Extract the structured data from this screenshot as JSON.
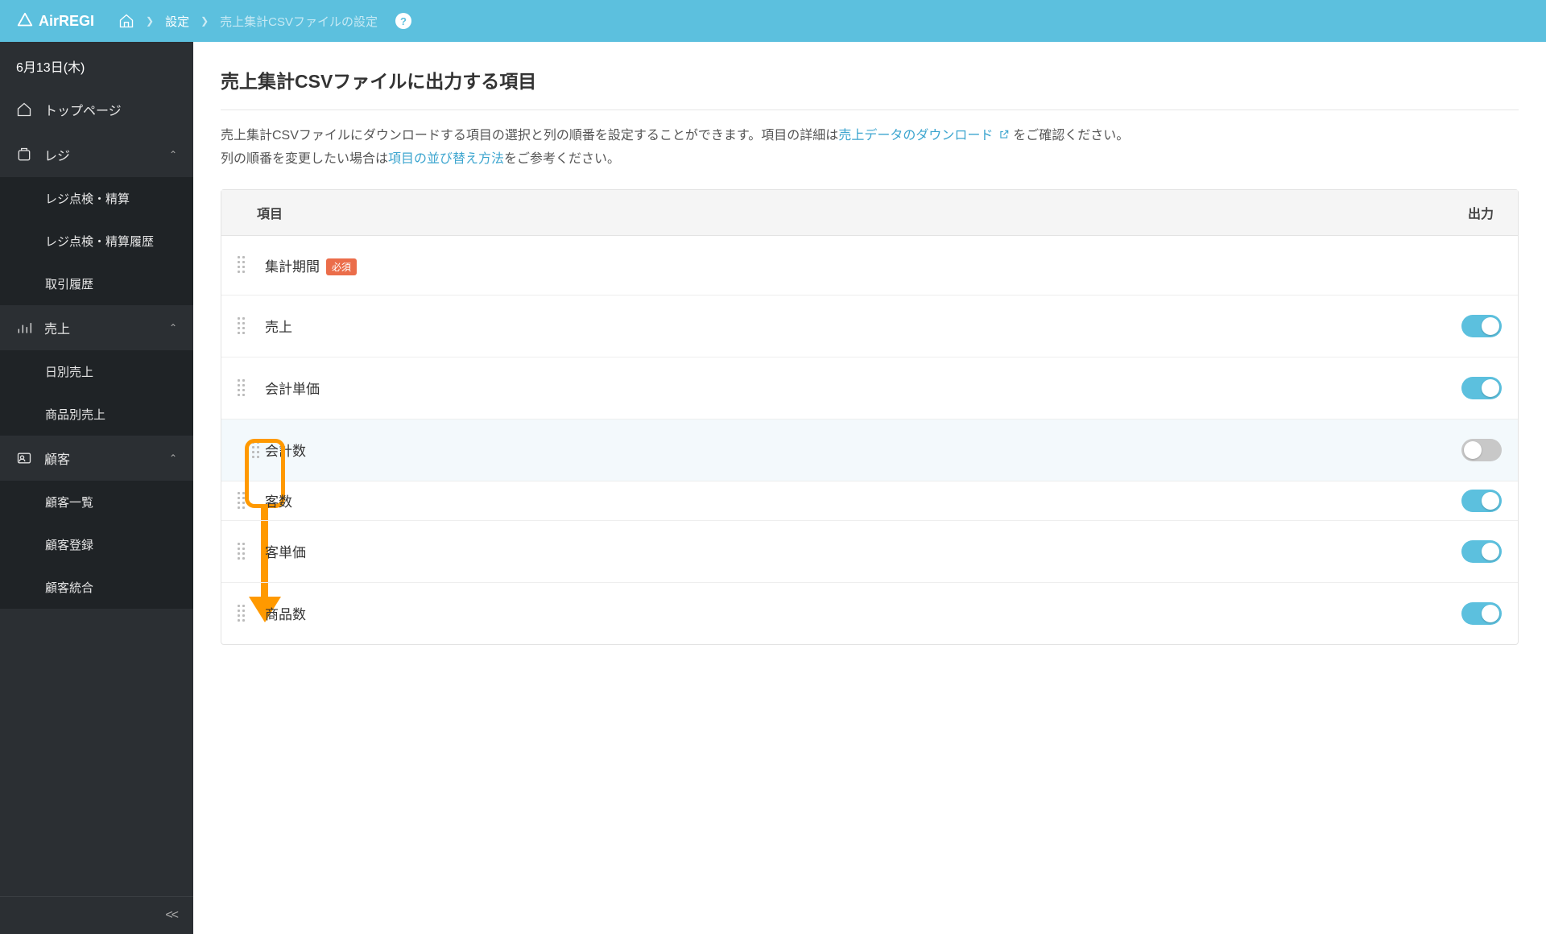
{
  "header": {
    "logo_text": "AirREGI",
    "breadcrumb": {
      "settings": "設定",
      "current": "売上集計CSVファイルの設定"
    }
  },
  "sidebar": {
    "date": "6月13日(木)",
    "items": [
      {
        "label": "トップページ",
        "icon": "home",
        "expandable": false
      },
      {
        "label": "レジ",
        "icon": "register",
        "expandable": true,
        "expanded": true
      },
      {
        "label": "レジ点検・精算",
        "sub": true
      },
      {
        "label": "レジ点検・精算履歴",
        "sub": true
      },
      {
        "label": "取引履歴",
        "sub": true
      },
      {
        "label": "売上",
        "icon": "chart",
        "expandable": true,
        "expanded": true
      },
      {
        "label": "日別売上",
        "sub": true
      },
      {
        "label": "商品別売上",
        "sub": true
      },
      {
        "label": "顧客",
        "icon": "customer",
        "expandable": true,
        "expanded": true
      },
      {
        "label": "顧客一覧",
        "sub": true
      },
      {
        "label": "顧客登録",
        "sub": true
      },
      {
        "label": "顧客統合",
        "sub": true
      }
    ]
  },
  "main": {
    "title": "売上集計CSVファイルに出力する項目",
    "desc_part1": "売上集計CSVファイルにダウンロードする項目の選択と列の順番を設定することができます。項目の詳細は",
    "desc_link1": "売上データのダウンロード",
    "desc_part2": "をご確認ください。",
    "desc_part3": "列の順番を変更したい場合は",
    "desc_link2": "項目の並び替え方法",
    "desc_part4": "をご参考ください。",
    "table_headers": {
      "item": "項目",
      "output": "出力"
    },
    "required_label": "必須",
    "rows": [
      {
        "label": "集計期間",
        "required": true,
        "toggle": null
      },
      {
        "label": "売上",
        "toggle": true
      },
      {
        "label": "会計単価",
        "toggle": true
      },
      {
        "label": "会計数",
        "toggle": false,
        "highlighted": true
      },
      {
        "label": "客数",
        "toggle": true
      },
      {
        "label": "客単価",
        "toggle": true
      },
      {
        "label": "商品数",
        "toggle": true
      }
    ]
  }
}
